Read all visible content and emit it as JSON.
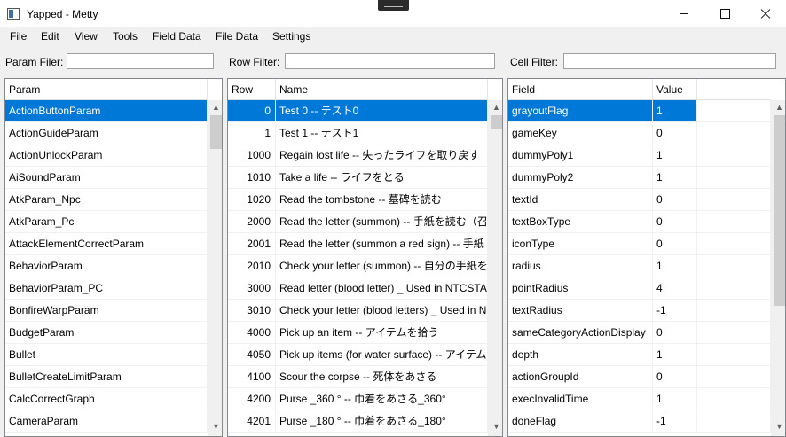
{
  "window": {
    "title": "Yapped - Metty"
  },
  "menu": [
    "File",
    "Edit",
    "View",
    "Tools",
    "Field Data",
    "File Data",
    "Settings"
  ],
  "filters": {
    "param_label": "Param Filer:",
    "row_label": "Row Filter:",
    "cell_label": "Cell Filter:",
    "param_value": "",
    "row_value": "",
    "cell_value": ""
  },
  "params": {
    "header": "Param",
    "selected_index": 0,
    "items": [
      "ActionButtonParam",
      "ActionGuideParam",
      "ActionUnlockParam",
      "AiSoundParam",
      "AtkParam_Npc",
      "AtkParam_Pc",
      "AttackElementCorrectParam",
      "BehaviorParam",
      "BehaviorParam_PC",
      "BonfireWarpParam",
      "BudgetParam",
      "Bullet",
      "BulletCreateLimitParam",
      "CalcCorrectGraph",
      "CameraParam"
    ]
  },
  "rows": {
    "headers": [
      "Row",
      "Name"
    ],
    "selected_index": 0,
    "items": [
      {
        "id": "0",
        "name": "Test 0 -- テスト0"
      },
      {
        "id": "1",
        "name": "Test 1 -- テスト1"
      },
      {
        "id": "1000",
        "name": "Regain lost life -- 失ったライフを取り戻す"
      },
      {
        "id": "1010",
        "name": "Take a life -- ライフをとる"
      },
      {
        "id": "1020",
        "name": "Read the tombstone -- 墓碑を読む"
      },
      {
        "id": "2000",
        "name": "Read the letter (summon) -- 手紙を読む（召"
      },
      {
        "id": "2001",
        "name": "Read the letter (summon a red sign) -- 手紙"
      },
      {
        "id": "2010",
        "name": "Check your letter (summon) -- 自分の手紙を"
      },
      {
        "id": "3000",
        "name": "Read letter (blood letter) _ Used in NTCSTAI"
      },
      {
        "id": "3010",
        "name": "Check your letter (blood letters) _ Used in N"
      },
      {
        "id": "4000",
        "name": "Pick up an item -- アイテムを拾う"
      },
      {
        "id": "4050",
        "name": "Pick up items (for water surface) -- アイテムを"
      },
      {
        "id": "4100",
        "name": "Scour the corpse -- 死体をあさる"
      },
      {
        "id": "4200",
        "name": "Purse _360 ° -- 巾着をあさる_360°"
      },
      {
        "id": "4201",
        "name": "Purse _180 ° -- 巾着をあさる_180°"
      }
    ]
  },
  "fields": {
    "headers": [
      "Field",
      "Value"
    ],
    "selected_index": 0,
    "items": [
      {
        "field": "grayoutFlag",
        "value": "1"
      },
      {
        "field": "gameKey",
        "value": "0"
      },
      {
        "field": "dummyPoly1",
        "value": "1"
      },
      {
        "field": "dummyPoly2",
        "value": "1"
      },
      {
        "field": "textId",
        "value": "0"
      },
      {
        "field": "textBoxType",
        "value": "0"
      },
      {
        "field": "iconType",
        "value": "0"
      },
      {
        "field": "radius",
        "value": "1"
      },
      {
        "field": "pointRadius",
        "value": "4"
      },
      {
        "field": "textRadius",
        "value": "-1"
      },
      {
        "field": "sameCategoryActionDisplay",
        "value": "0"
      },
      {
        "field": "depth",
        "value": "1"
      },
      {
        "field": "actionGroupId",
        "value": "0"
      },
      {
        "field": "execInvalidTime",
        "value": "1"
      },
      {
        "field": "doneFlag",
        "value": "-1"
      }
    ]
  },
  "colors": {
    "selection": "#0078d7",
    "background": "#f0f0f0"
  },
  "icons": [
    "app-icon",
    "minimize-icon",
    "maximize-icon",
    "close-icon",
    "scroll-up-icon",
    "scroll-down-icon"
  ]
}
